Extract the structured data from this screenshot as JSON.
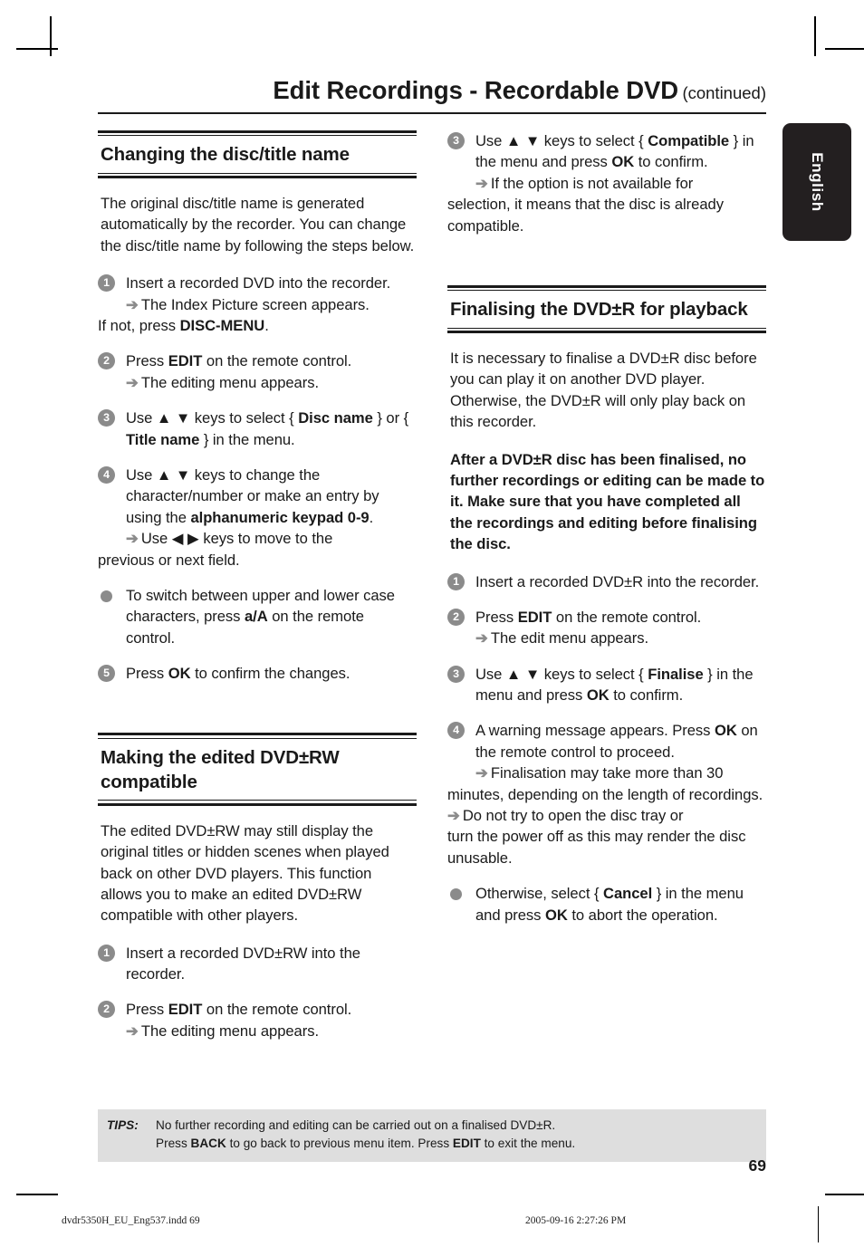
{
  "running_head": {
    "title": "Edit Recordings - Recordable DVD",
    "continued": "(continued)"
  },
  "language_tab": {
    "label": "English"
  },
  "left_column": {
    "section1": {
      "heading": "Changing the disc/title name",
      "intro": "The original disc/title name is generated automatically by the recorder. You can change the disc/title name by following the steps below.",
      "steps": [
        {
          "marker": "1",
          "text_1": "Insert a recorded DVD into the recorder.",
          "arrow": "➔",
          "sub_1": "The Index Picture screen appears.",
          "tail_plain_1": "If not, press ",
          "tail_bold_1": "DISC-MENU",
          "tail_plain_2": "."
        },
        {
          "marker": "2",
          "plain_1": "Press ",
          "bold_1": "EDIT",
          "plain_2": " on the remote control.",
          "arrow": "➔",
          "sub_1": "The editing menu appears."
        },
        {
          "marker": "3",
          "plain_1": "Use ▲ ▼ keys to select { ",
          "bold_1": "Disc name",
          "plain_2": " } or { ",
          "bold_2": "Title name",
          "plain_3": " } in the menu."
        },
        {
          "marker": "4",
          "plain_1": "Use ▲ ▼ keys to change the character/number or make an entry by using the ",
          "bold_1": "alphanumeric keypad 0-9",
          "plain_2": ".",
          "arrow": "➔",
          "sub_1": "Use ◀ ▶ keys to move to the",
          "tail_plain_1": "previous or next field."
        },
        {
          "marker": "●",
          "is_dot": true,
          "plain_1": "To switch between upper and lower case characters, press ",
          "bold_1": "a/A",
          "plain_2": " on the remote control."
        },
        {
          "marker": "5",
          "plain_1": "Press ",
          "bold_1": "OK",
          "plain_2": " to confirm the changes."
        }
      ]
    },
    "section2": {
      "heading": "Making the edited DVD±RW compatible",
      "intro": "The edited DVD±RW may still display the original titles or hidden scenes when played back on other DVD players. This function allows you to make an edited DVD±RW compatible with other players.",
      "steps": [
        {
          "marker": "1",
          "plain_1": "Insert a recorded DVD±RW into the recorder."
        },
        {
          "marker": "2",
          "plain_1": "Press ",
          "bold_1": "EDIT",
          "plain_2": " on the remote control.",
          "arrow": "➔",
          "sub_1": "The editing menu appears."
        }
      ]
    }
  },
  "right_column": {
    "continued_step": {
      "marker": "3",
      "plain_1": "Use ▲ ▼ keys to select { ",
      "bold_1": "Compatible",
      "plain_2": " } in the menu and press ",
      "bold_2": "OK",
      "plain_3": " to confirm.",
      "arrow": "➔",
      "sub_1": "If the option is not available for",
      "tail_plain_1": "selection, it means that the disc is already compatible."
    },
    "section3": {
      "heading": "Finalising the DVD±R for playback",
      "intro": "It is necessary to finalise a DVD±R disc before you can play it on another DVD player. Otherwise, the DVD±R will only play back on this recorder.",
      "warning": "After a DVD±R disc has been finalised, no further recordings or editing can be made to it. Make sure that you have completed all the recordings and editing before finalising the disc.",
      "steps": [
        {
          "marker": "1",
          "plain_1": "Insert a recorded DVD±R into the recorder."
        },
        {
          "marker": "2",
          "plain_1": "Press ",
          "bold_1": "EDIT",
          "plain_2": " on the remote control.",
          "arrow": "➔",
          "sub_1": "The edit menu appears."
        },
        {
          "marker": "3",
          "plain_1": "Use ▲ ▼ keys to select { ",
          "bold_1": "Finalise",
          "plain_2": " } in the menu and press ",
          "bold_2": "OK",
          "plain_3": " to confirm."
        },
        {
          "marker": "4",
          "plain_1": "A warning message appears. Press ",
          "bold_1": "OK",
          "plain_2": " on the remote control to proceed.",
          "arrow": "➔",
          "sub_1": "Finalisation may take more than 30",
          "tail_plain_1": "minutes, depending on the length of recordings.",
          "arrow_2": "➔",
          "sub_2": "Do not try to open the disc tray or",
          "tail_plain_2": "turn the power off as this may render the disc unusable."
        },
        {
          "marker": "●",
          "is_dot": true,
          "plain_1": "Otherwise, select { ",
          "bold_1": "Cancel",
          "plain_2": " } in the menu and press ",
          "bold_2": "OK",
          "plain_3": " to abort the operation."
        }
      ]
    }
  },
  "tips": {
    "label": "TIPS:",
    "line1": "No further recording and editing can be carried out on a finalised DVD±R.",
    "line2_a": "Press ",
    "line2_b": "BACK",
    "line2_c": " to go back to previous menu item. Press ",
    "line2_d": "EDIT",
    "line2_e": " to exit the menu."
  },
  "page_number": "69",
  "print_footer": {
    "file": "dvdr5350H_EU_Eng537.indd   69",
    "timestamp": "2005-09-16   2:27:26 PM"
  },
  "colors": {
    "marker_grey": "#8b8b8b",
    "tips_bg": "#dedede",
    "tab_bg": "#231f20",
    "ink": "#1a1a1a"
  }
}
